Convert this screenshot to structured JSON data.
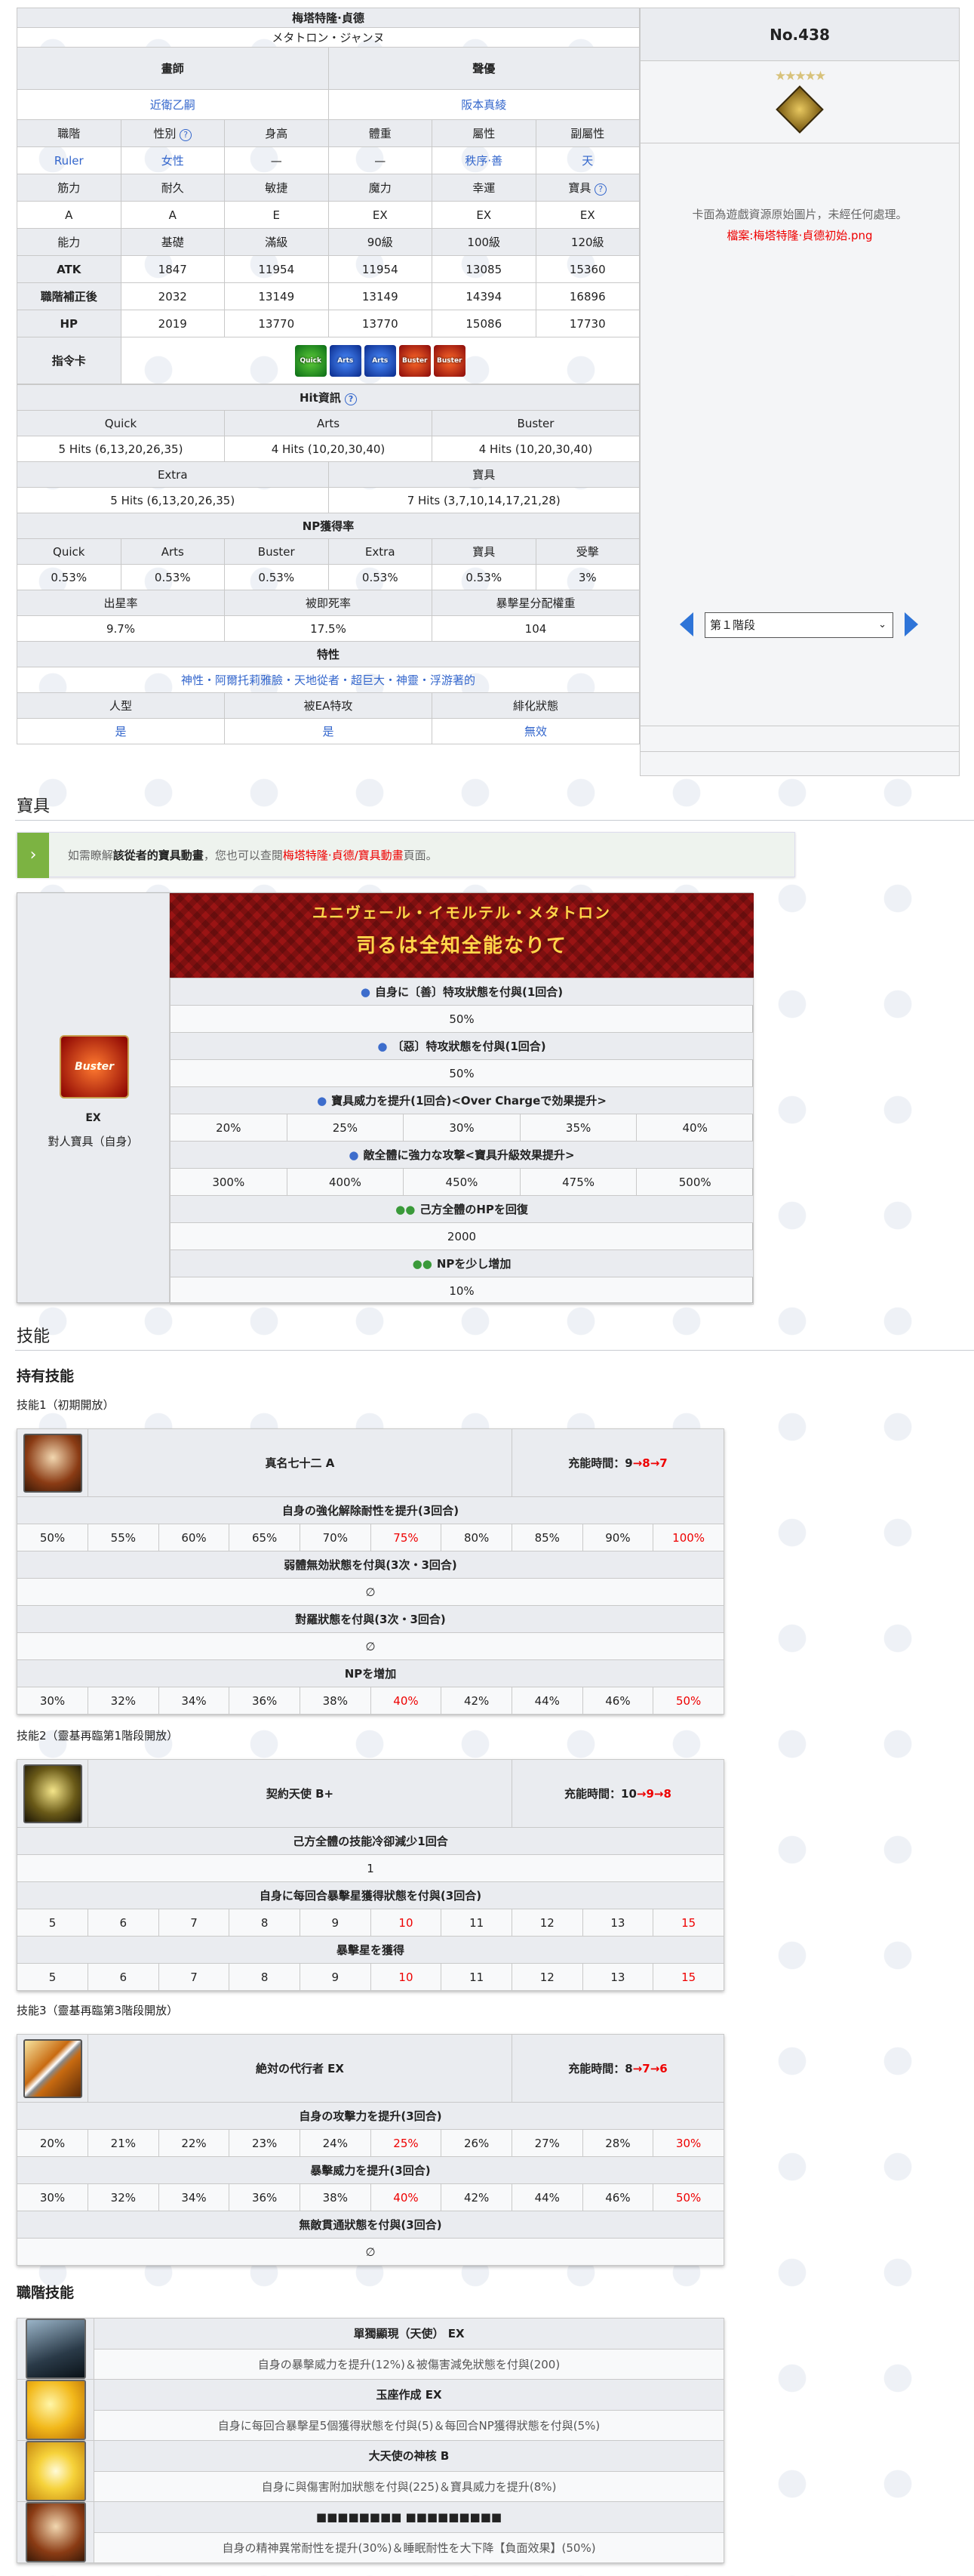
{
  "profile": {
    "name_zh": "梅塔特隆·貞德",
    "name_ja": "メタトロン・ジャンヌ",
    "label_illust": "畫師",
    "label_cv": "聲優",
    "illust": "近衛乙嗣",
    "cv": "阪本真綾",
    "h_class": "職階",
    "h_gender": "性別",
    "h_height": "身高",
    "h_weight": "體重",
    "h_attr": "屬性",
    "h_subattr": "副屬性",
    "class": "Ruler",
    "gender": "女性",
    "height": "—",
    "weight": "—",
    "alignment": "秩序·善",
    "subattr": "天",
    "h_str": "筋力",
    "h_end": "耐久",
    "h_agi": "敏捷",
    "h_mag": "魔力",
    "h_luk": "幸運",
    "h_np": "寶具",
    "str": "A",
    "end": "A",
    "agi": "E",
    "mag": "EX",
    "luk": "EX",
    "np": "EX",
    "h_level": "能力",
    "h_base": "基礎",
    "h_max": "滿級",
    "h_90": "90級",
    "h_100": "100級",
    "h_120": "120級",
    "atk_label": "ATK",
    "atk": [
      "1847",
      "11954",
      "11954",
      "13085",
      "15360"
    ],
    "corr_label": "職階補正後",
    "corr": [
      "2032",
      "13149",
      "13149",
      "14394",
      "16896"
    ],
    "hp_label": "HP",
    "hp": [
      "2019",
      "13770",
      "13770",
      "15086",
      "17730"
    ],
    "cards_label": "指令卡",
    "cards": [
      "Quick",
      "Arts",
      "Arts",
      "Buster",
      "Buster"
    ],
    "hit_label": "Hit資訊",
    "h_quick": "Quick",
    "h_arts": "Arts",
    "h_buster": "Buster",
    "h_extra": "Extra",
    "h_npw": "寶具",
    "hit_quick": "5 Hits (6,13,20,26,35)",
    "hit_arts": "4 Hits (10,20,30,40)",
    "hit_buster": "4 Hits (10,20,30,40)",
    "hit_extra": "5 Hits (6,13,20,26,35)",
    "hit_np": "7 Hits (3,7,10,14,17,21,28)",
    "np_gain_label": "NP獲得率",
    "h_np_np": "寶具",
    "h_hurt": "受擊",
    "np_gain": [
      "0.53%",
      "0.53%",
      "0.53%",
      "0.53%",
      "0.53%",
      "3%"
    ],
    "h_star": "出星率",
    "h_death": "被即死率",
    "h_weight_star": "暴擊星分配權重",
    "star": "9.7%",
    "death": "17.5%",
    "starw": "104",
    "traits_label": "特性",
    "traits": "神性・阿爾托莉雅臉・天地從者・超巨大・神靈・浮游著的",
    "h_human": "人型",
    "h_ea": "被EA特攻",
    "h_seal": "緋化狀態",
    "human": "是",
    "ea": "是",
    "seal": "無效"
  },
  "sidebar": {
    "number": "No.438",
    "stars": "★★★★★",
    "note": "卡面為遊戲資源原始圖片，未經任何處理。",
    "file": "檔案:梅塔特隆·貞德初始.png",
    "stage_select": "第１階段"
  },
  "np_section": {
    "title": "寶具",
    "notice_pre": "如需瞭解",
    "notice_bold": "該從者的寶具動畫",
    "notice_mid": "，您也可以查閱",
    "notice_link": "梅塔特隆·貞德/寶具動畫",
    "notice_post": "頁面。",
    "card": "Buster",
    "rank": "EX",
    "type": "對人寶具（自身）",
    "ruby": "ユニヴェール・イモルテル・メタトロン",
    "name": "司るは全知全能なりて",
    "e1": "自身に〔善〕特攻狀態を付與(1回合)",
    "e1v": "50%",
    "e2": "〔惡〕特攻狀態を付與(1回合)",
    "e2v": "50%",
    "e3": "寶具威力を提升(1回合)<Over Chargeで効果提升>",
    "e3v": [
      "20%",
      "25%",
      "30%",
      "35%",
      "40%"
    ],
    "e4": "敵全體に強力な攻撃<寶具升級效果提升>",
    "e4v": [
      "300%",
      "400%",
      "450%",
      "475%",
      "500%"
    ],
    "e5": "己方全體のHPを回復",
    "e5v": "2000",
    "e6": "NPを少し增加",
    "e6v": "10%"
  },
  "skills": {
    "title": "技能",
    "own": "持有技能",
    "s1_sub": "技能1（初期開放）",
    "s1_name": "真名七十二 A",
    "s1_cd_label": "充能時間：",
    "s1_cd": [
      "9",
      "→8",
      "→7"
    ],
    "s1_e1": "自身の強化解除耐性を提升(3回合)",
    "s1_e1v": [
      "50%",
      "55%",
      "60%",
      "65%",
      "70%",
      "75%",
      "80%",
      "85%",
      "90%",
      "100%"
    ],
    "s1_e2": "弱體無効狀態を付與(3次・3回合)",
    "s1_e2v": "∅",
    "s1_e3": "對羅狀態を付與(3次・3回合)",
    "s1_e3v": "∅",
    "s1_e4": "NPを增加",
    "s1_e4v": [
      "30%",
      "32%",
      "34%",
      "36%",
      "38%",
      "40%",
      "42%",
      "44%",
      "46%",
      "50%"
    ],
    "s2_sub": "技能2（靈基再臨第1階段開放）",
    "s2_name": "契約天使 B+",
    "s2_cd": [
      "10",
      "→9",
      "→8"
    ],
    "s2_e1": "己方全體の技能冷卻減少1回合",
    "s2_e1v": "1",
    "s2_e2": "自身に每回合暴擊星獲得狀態を付與(3回合)",
    "s2_e2v": [
      "5",
      "6",
      "7",
      "8",
      "9",
      "10",
      "11",
      "12",
      "13",
      "15"
    ],
    "s2_e3": "暴擊星を獲得",
    "s2_e3v": [
      "5",
      "6",
      "7",
      "8",
      "9",
      "10",
      "11",
      "12",
      "13",
      "15"
    ],
    "s3_sub": "技能3（靈基再臨第3階段開放）",
    "s3_name": "絶対の代行者 EX",
    "s3_cd": [
      "8",
      "→7",
      "→6"
    ],
    "s3_e1": "自身の攻擊力を提升(3回合)",
    "s3_e1v": [
      "20%",
      "21%",
      "22%",
      "23%",
      "24%",
      "25%",
      "26%",
      "27%",
      "28%",
      "30%"
    ],
    "s3_e2": "暴擊威力を提升(3回合)",
    "s3_e2v": [
      "30%",
      "32%",
      "34%",
      "36%",
      "38%",
      "40%",
      "42%",
      "44%",
      "46%",
      "50%"
    ],
    "s3_e3": "無敵貫通狀態を付與(3回合)",
    "s3_e3v": "∅",
    "class_title": "職階技能",
    "c1_name": "單獨顯現（天使） EX",
    "c1_desc": "自身の暴擊威力を提升(12%)＆被傷害減免狀態を付與(200)",
    "c2_name": "玉座作成 EX",
    "c2_desc": "自身に每回合暴擊星5個獲得狀態を付與(5)＆每回合NP獲得狀態を付與(5%)",
    "c3_name": "大天使の神核 B",
    "c3_desc": "自身に與傷害附加狀態を付與(225)＆寶具威力を提升(8%)",
    "c4_name": "■■■■■■■■ ■■■■■■■■■",
    "c4_desc": "自身の精神異常耐性を提升(30%)＆睡眠耐性を大下降【負面效果】(50%)"
  }
}
